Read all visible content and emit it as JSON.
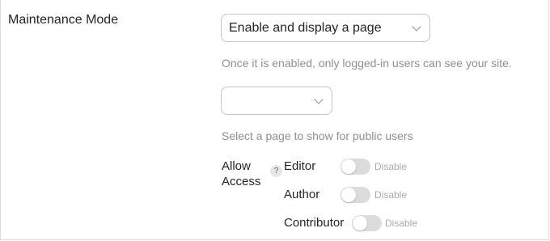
{
  "setting": {
    "label": "Maintenance Mode",
    "mode_select": {
      "value": "Enable and display a page"
    },
    "mode_help": "Once it is enabled, only logged-in users can see your site.",
    "page_select": {
      "value": ""
    },
    "page_help": "Select a page to show for public users"
  },
  "access": {
    "label_line1": "Allow",
    "label_line2": "Access",
    "help_icon_glyph": "?",
    "roles": [
      {
        "name": "Editor",
        "state": "Disable",
        "enabled": false
      },
      {
        "name": "Author",
        "state": "Disable",
        "enabled": false
      },
      {
        "name": "Contributor",
        "state": "Disable",
        "enabled": false
      }
    ]
  },
  "colors": {
    "help_text": "#8c8f94",
    "toggle_off": "#dcdcde",
    "border": "#c3c4c7"
  },
  "icons": {
    "select_arrow": "chevron-down-icon",
    "help": "question-mark-icon"
  }
}
